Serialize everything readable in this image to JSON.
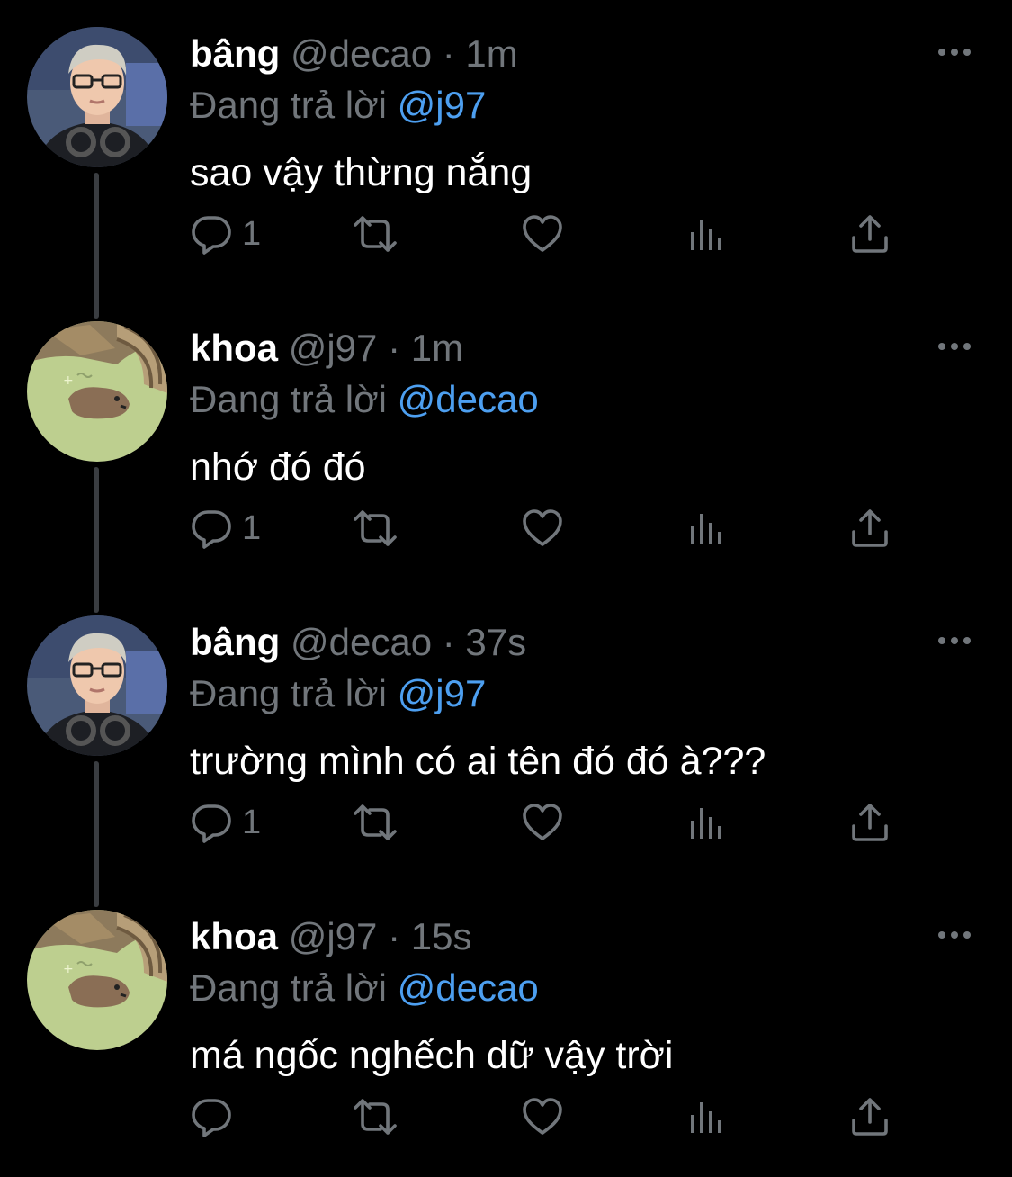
{
  "colors": {
    "background": "#000000",
    "mention": "#4d9ff0",
    "muted": "#71767b",
    "text": "#ffffff"
  },
  "tweets": [
    {
      "name": "bâng",
      "handle": "@decao",
      "dot": "·",
      "time": "1m",
      "reply_prefix": "Đang trả lời",
      "reply_to": "@j97",
      "text": "sao vậy thừng nắng",
      "reply_count": "1",
      "avatar": "person-glasses"
    },
    {
      "name": "khoa",
      "handle": "@j97",
      "dot": "·",
      "time": "1m",
      "reply_prefix": "Đang trả lời",
      "reply_to": "@decao",
      "text": "nhớ đó đó",
      "reply_count": "1",
      "avatar": "pixel-animal"
    },
    {
      "name": "bâng",
      "handle": "@decao",
      "dot": "·",
      "time": "37s",
      "reply_prefix": "Đang trả lời",
      "reply_to": "@j97",
      "text": "trường mình có ai tên đó đó à???",
      "reply_count": "1",
      "avatar": "person-glasses"
    },
    {
      "name": "khoa",
      "handle": "@j97",
      "dot": "·",
      "time": "15s",
      "reply_prefix": "Đang trả lời",
      "reply_to": "@decao",
      "text": "má ngốc nghếch dữ vậy trời",
      "reply_count": "",
      "avatar": "pixel-animal"
    }
  ]
}
